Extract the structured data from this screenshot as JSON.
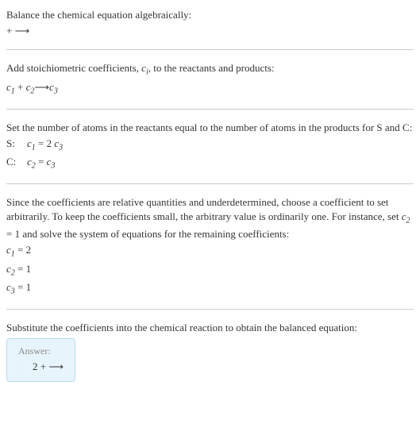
{
  "title": "Balance the chemical equation algebraically:",
  "react_line": " +  ⟶ ",
  "step1": {
    "intro1": "Add stoichiometric coefficients, ",
    "ci": "c",
    "ci_sub": "i",
    "intro2": ", to the reactants and products:",
    "expr_c1": "c",
    "expr_c1_sub": "1",
    "expr_plus": " + ",
    "expr_c2": "c",
    "expr_c2_sub": "2",
    "expr_arrow": "  ⟶ ",
    "expr_c3": "c",
    "expr_c3_sub": "3"
  },
  "step2": {
    "intro": "Set the number of atoms in the reactants equal to the number of atoms in the products for S and C:",
    "rowS_label": "S:",
    "rowS_c1": "c",
    "rowS_c1_sub": "1",
    "rowS_eq": " = 2 ",
    "rowS_c3": "c",
    "rowS_c3_sub": "3",
    "rowC_label": "C:",
    "rowC_c2": "c",
    "rowC_c2_sub": "2",
    "rowC_eq": " = ",
    "rowC_c3": "c",
    "rowC_c3_sub": "3"
  },
  "step3": {
    "intro1": "Since the coefficients are relative quantities and underdetermined, choose a coefficient to set arbitrarily. To keep the coefficients small, the arbitrary value is ordinarily one. For instance, set ",
    "c2": "c",
    "c2_sub": "2",
    "intro2": " = 1 and solve the system of equations for the remaining coefficients:",
    "r1_c": "c",
    "r1_sub": "1",
    "r1_val": " = 2",
    "r2_c": "c",
    "r2_sub": "2",
    "r2_val": " = 1",
    "r3_c": "c",
    "r3_sub": "3",
    "r3_val": " = 1"
  },
  "step4": {
    "intro": "Substitute the coefficients into the chemical reaction to obtain the balanced equation:"
  },
  "answer": {
    "title": "Answer:",
    "line": "2  +   ⟶ "
  }
}
